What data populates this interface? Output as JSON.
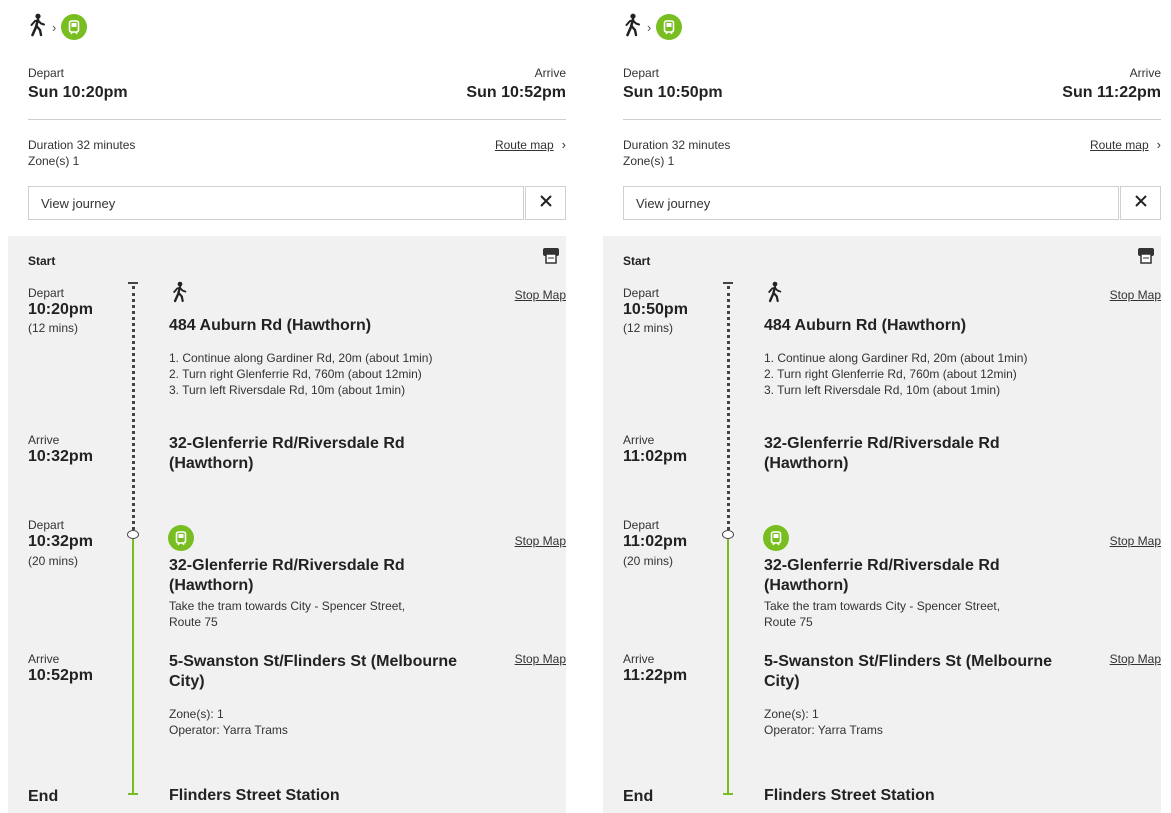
{
  "journeys": [
    {
      "modes": [
        {
          "icon": "walk-icon"
        },
        {
          "separator": "›"
        },
        {
          "icon": "tram-icon"
        }
      ],
      "depart_label": "Depart",
      "depart_time": "Sun 10:20pm",
      "arrive_label": "Arrive",
      "arrive_time": "Sun 10:52pm",
      "duration": "Duration 32 minutes",
      "zones": "Zone(s) 1",
      "route_map_label": "Route map",
      "route_map_chevron": "›",
      "view_journey_label": "View journey",
      "close_label": "✕",
      "start_label": "Start",
      "end_label": "End",
      "walk": {
        "depart_label": "Depart",
        "depart_time": "10:20pm",
        "depart_duration": "(12 mins)",
        "stop_map_label": "Stop Map",
        "origin": "484 Auburn Rd (Hawthorn)",
        "steps": [
          "1. Continue along Gardiner Rd, 20m (about 1min)",
          "2. Turn right Glenferrie Rd, 760m (about 12min)",
          "3. Turn left Riversdale Rd, 10m (about 1min)"
        ],
        "arrive_label": "Arrive",
        "arrive_time": "10:32pm",
        "arrive_stop_line1": "32-Glenferrie Rd/Riversdale Rd",
        "arrive_stop_line2": "(Hawthorn)"
      },
      "tram": {
        "depart_label": "Depart",
        "depart_time": "10:32pm",
        "depart_duration": "(20 mins)",
        "stop_map_label": "Stop Map",
        "from_line1": "32-Glenferrie Rd/Riversdale Rd",
        "from_line2": "(Hawthorn)",
        "instruction_line1": "Take the tram towards City - Spencer Street,",
        "instruction_line2": "Route 75",
        "arrive_label": "Arrive",
        "arrive_time": "10:52pm",
        "arrive_stop_map_label": "Stop Map",
        "to_line1": "5-Swanston St/Flinders St (Melbourne",
        "to_line2": "City)",
        "zones": "Zone(s): 1",
        "operator": "Operator: Yarra Trams"
      },
      "end_station": "Flinders Street Station"
    },
    {
      "modes": [
        {
          "icon": "walk-icon"
        },
        {
          "separator": "›"
        },
        {
          "icon": "tram-icon"
        }
      ],
      "depart_label": "Depart",
      "depart_time": "Sun 10:50pm",
      "arrive_label": "Arrive",
      "arrive_time": "Sun 11:22pm",
      "duration": "Duration 32 minutes",
      "zones": "Zone(s) 1",
      "route_map_label": "Route map",
      "route_map_chevron": "›",
      "view_journey_label": "View journey",
      "close_label": "✕",
      "start_label": "Start",
      "end_label": "End",
      "walk": {
        "depart_label": "Depart",
        "depart_time": "10:50pm",
        "depart_duration": "(12 mins)",
        "stop_map_label": "Stop Map",
        "origin": "484 Auburn Rd (Hawthorn)",
        "steps": [
          "1. Continue along Gardiner Rd, 20m (about 1min)",
          "2. Turn right Glenferrie Rd, 760m (about 12min)",
          "3. Turn left Riversdale Rd, 10m (about 1min)"
        ],
        "arrive_label": "Arrive",
        "arrive_time": "11:02pm",
        "arrive_stop_line1": "32-Glenferrie Rd/Riversdale Rd",
        "arrive_stop_line2": "(Hawthorn)"
      },
      "tram": {
        "depart_label": "Depart",
        "depart_time": "11:02pm",
        "depart_duration": "(20 mins)",
        "stop_map_label": "Stop Map",
        "from_line1": "32-Glenferrie Rd/Riversdale Rd",
        "from_line2": "(Hawthorn)",
        "instruction_line1": "Take the tram towards City - Spencer Street,",
        "instruction_line2": "Route 75",
        "arrive_label": "Arrive",
        "arrive_time": "11:22pm",
        "arrive_stop_map_label": "Stop Map",
        "to_line1": "5-Swanston St/Flinders St (Melbourne",
        "to_line2": "City)",
        "zones": "Zone(s): 1",
        "operator": "Operator: Yarra Trams"
      },
      "end_station": "Flinders Street Station"
    }
  ],
  "colors": {
    "tram_green": "#78be20",
    "panel_bg": "#f1f1f1",
    "divider": "#cfcfcf"
  }
}
